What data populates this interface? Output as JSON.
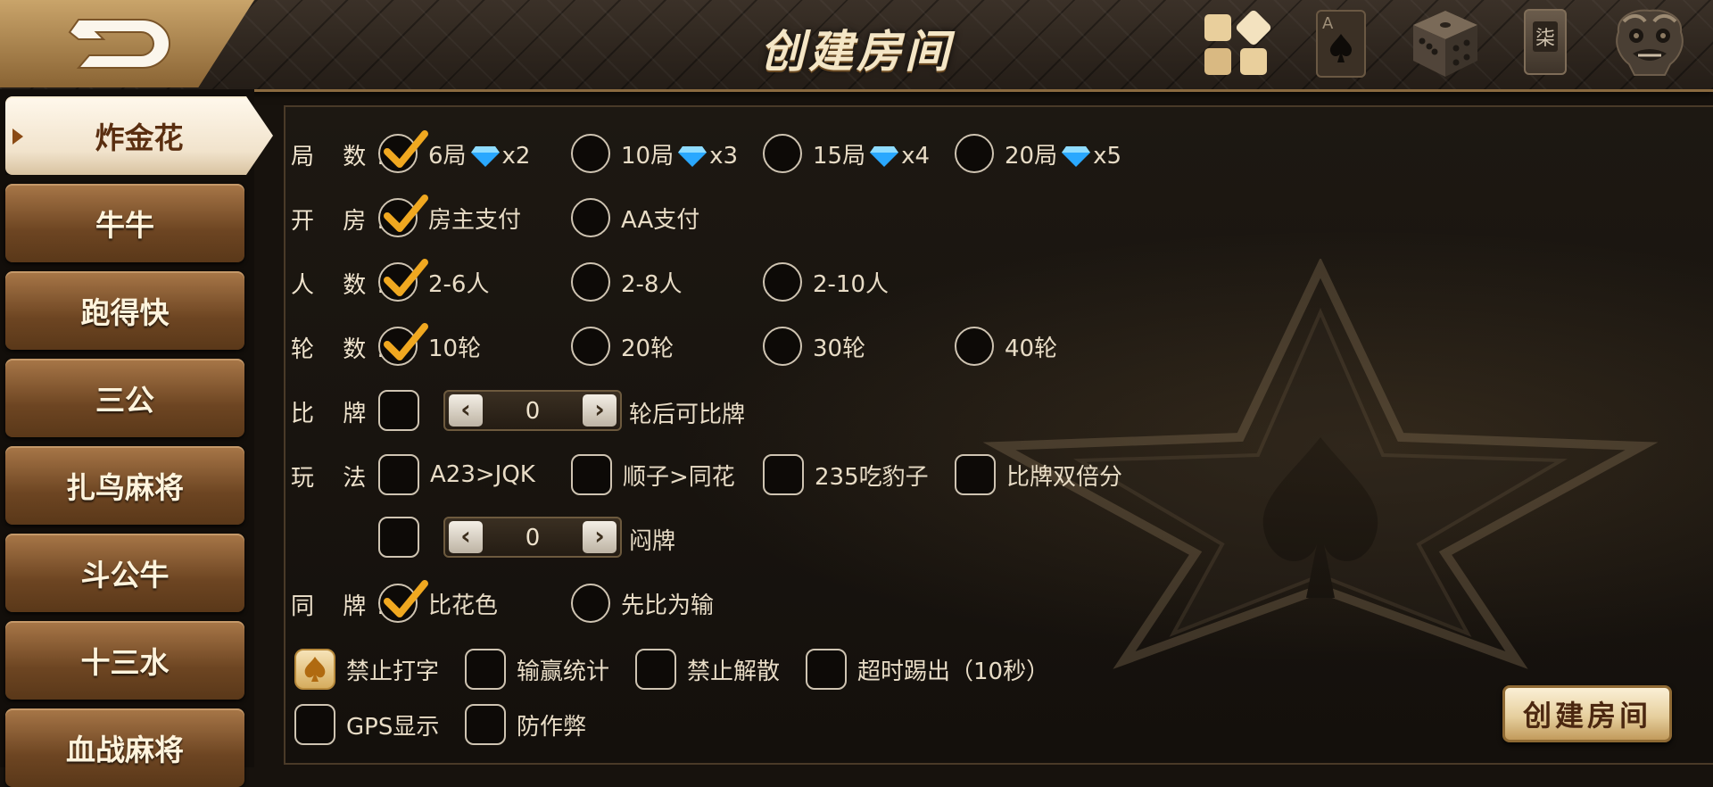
{
  "title": "创建房间",
  "colors": {
    "accent_gold": "#f0a820",
    "brown": "#6d4522",
    "gem_blue": "#2aa8ff"
  },
  "top_icons": [
    "apps-icon",
    "ace-of-spades-card-icon",
    "dice-icon",
    "mahjong-tile-icon",
    "lion-mask-icon"
  ],
  "mahjong_tile_char": "柒",
  "card_rank": "A",
  "sidebar": {
    "items": [
      {
        "label": "炸金花",
        "active": true
      },
      {
        "label": "牛牛"
      },
      {
        "label": "跑得快"
      },
      {
        "label": "三公"
      },
      {
        "label": "扎鸟麻将"
      },
      {
        "label": "斗公牛"
      },
      {
        "label": "十三水"
      },
      {
        "label": "血战麻将"
      }
    ]
  },
  "rounds": {
    "label": "局 数:",
    "options": [
      {
        "text": "6局",
        "gem": "x2",
        "checked": true
      },
      {
        "text": "10局",
        "gem": "x3",
        "checked": false
      },
      {
        "text": "15局",
        "gem": "x4",
        "checked": false
      },
      {
        "text": "20局",
        "gem": "x5",
        "checked": false
      }
    ]
  },
  "payment": {
    "label": "开 房:",
    "options": [
      {
        "text": "房主支付",
        "checked": true
      },
      {
        "text": "AA支付",
        "checked": false
      }
    ]
  },
  "players": {
    "label": "人 数:",
    "options": [
      {
        "text": "2-6人",
        "checked": true
      },
      {
        "text": "2-8人",
        "checked": false
      },
      {
        "text": "2-10人",
        "checked": false
      }
    ]
  },
  "turns": {
    "label": "轮 数:",
    "options": [
      {
        "text": "10轮",
        "checked": true
      },
      {
        "text": "20轮",
        "checked": false
      },
      {
        "text": "30轮",
        "checked": false
      },
      {
        "text": "40轮",
        "checked": false
      }
    ]
  },
  "compare": {
    "label": "比 牌:",
    "checked": false,
    "value": "0",
    "suffix": "轮后可比牌"
  },
  "play": {
    "label": "玩 法:",
    "options": [
      {
        "text": "A23>JQK",
        "checked": false
      },
      {
        "text": "顺子>同花",
        "checked": false
      },
      {
        "text": "235吃豹子",
        "checked": false
      },
      {
        "text": "比牌双倍分",
        "checked": false
      }
    ],
    "blind": {
      "checked": false,
      "value": "0",
      "suffix": "闷牌"
    }
  },
  "same_hand": {
    "label": "同 牌:",
    "options": [
      {
        "text": "比花色",
        "checked": true
      },
      {
        "text": "先比为输",
        "checked": false
      }
    ]
  },
  "extras": [
    {
      "text": "禁止打字",
      "checked": true
    },
    {
      "text": "输赢统计",
      "checked": false
    },
    {
      "text": "禁止解散",
      "checked": false
    },
    {
      "text": "超时踢出（10秒）",
      "checked": false
    },
    {
      "text": "GPS显示",
      "checked": false
    },
    {
      "text": "防作弊",
      "checked": false
    }
  ],
  "create_button": "创建房间"
}
